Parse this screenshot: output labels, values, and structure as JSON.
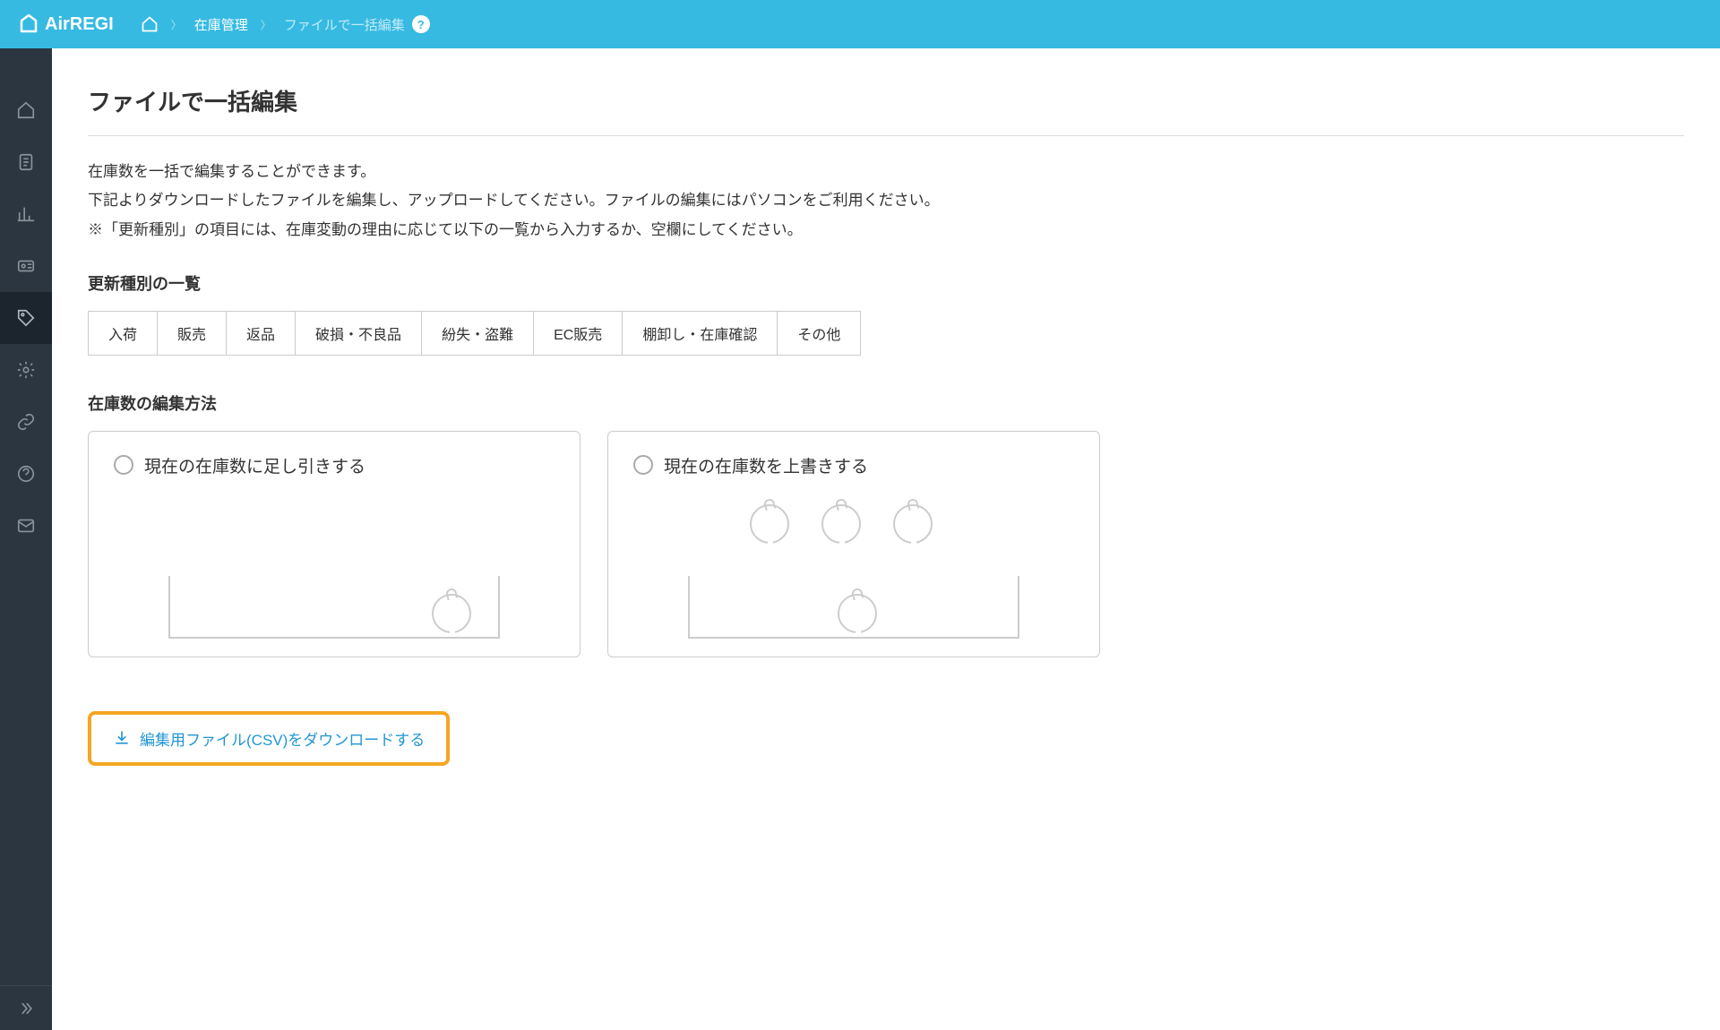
{
  "brand": "AirREGI",
  "breadcrumb": {
    "item1": "在庫管理",
    "current": "ファイルで一括編集"
  },
  "page": {
    "title": "ファイルで一括編集",
    "desc1": "在庫数を一括で編集することができます。",
    "desc2": "下記よりダウンロードしたファイルを編集し、アップロードしてください。ファイルの編集にはパソコンをご利用ください。",
    "desc3": "※「更新種別」の項目には、在庫変動の理由に応じて以下の一覧から入力するか、空欄にしてください。"
  },
  "updateTypes": {
    "heading": "更新種別の一覧",
    "items": [
      "入荷",
      "販売",
      "返品",
      "破損・不良品",
      "紛失・盗難",
      "EC販売",
      "棚卸し・在庫確認",
      "その他"
    ]
  },
  "editMethod": {
    "heading": "在庫数の編集方法",
    "option1": "現在の在庫数に足し引きする",
    "option2": "現在の在庫数を上書きする"
  },
  "download": {
    "label": "編集用ファイル(CSV)をダウンロードする"
  }
}
